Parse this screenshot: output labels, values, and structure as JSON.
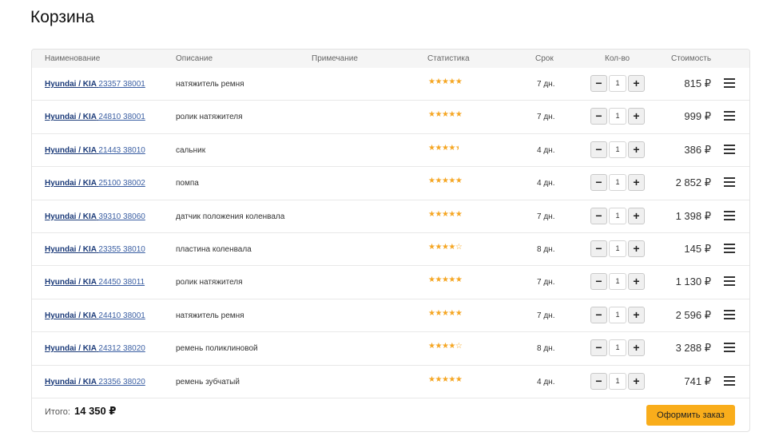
{
  "page": {
    "title": "Корзина"
  },
  "headers": {
    "name": "Наименование",
    "description": "Описание",
    "note": "Примечание",
    "stats": "Статистика",
    "term": "Срок",
    "qty": "Кол-во",
    "cost": "Стоимость"
  },
  "icons": {
    "decrement": "minus-icon",
    "increment": "plus-icon",
    "menu": "hamburger-menu-icon",
    "rating": "star-icon"
  },
  "colors": {
    "accent": "#f9ad1b",
    "star": "#f5a623",
    "link": "#1d3c7a"
  },
  "items": [
    {
      "brand": "Hyundai / KIA",
      "article": "23357 38001",
      "description": "натяжитель ремня",
      "rating": 5,
      "term": "7 дн.",
      "qty": "1",
      "cost": "815 ₽"
    },
    {
      "brand": "Hyundai / KIA",
      "article": "24810 38001",
      "description": "ролик натяжителя",
      "rating": 5,
      "term": "7 дн.",
      "qty": "1",
      "cost": "999 ₽"
    },
    {
      "brand": "Hyundai / KIA",
      "article": "21443 38010",
      "description": "сальник",
      "rating": 4.5,
      "term": "4 дн.",
      "qty": "1",
      "cost": "386 ₽"
    },
    {
      "brand": "Hyundai / KIA",
      "article": "25100 38002",
      "description": "помпа",
      "rating": 5,
      "term": "4 дн.",
      "qty": "1",
      "cost": "2 852 ₽"
    },
    {
      "brand": "Hyundai / KIA",
      "article": "39310 38060",
      "description": "датчик положения коленвала",
      "rating": 5,
      "term": "7 дн.",
      "qty": "1",
      "cost": "1 398 ₽"
    },
    {
      "brand": "Hyundai / KIA",
      "article": "23355 38010",
      "description": "пластина коленвала",
      "rating": 4,
      "term": "8 дн.",
      "qty": "1",
      "cost": "145 ₽"
    },
    {
      "brand": "Hyundai / KIA",
      "article": "24450 38011",
      "description": "ролик натяжителя",
      "rating": 5,
      "term": "7 дн.",
      "qty": "1",
      "cost": "1 130 ₽"
    },
    {
      "brand": "Hyundai / KIA",
      "article": "24410 38001",
      "description": "натяжитель ремня",
      "rating": 5,
      "term": "7 дн.",
      "qty": "1",
      "cost": "2 596 ₽"
    },
    {
      "brand": "Hyundai / KIA",
      "article": "24312 38020",
      "description": "ремень поликлиновой",
      "rating": 4,
      "term": "8 дн.",
      "qty": "1",
      "cost": "3 288 ₽"
    },
    {
      "brand": "Hyundai / KIA",
      "article": "23356 38020",
      "description": "ремень зубчатый",
      "rating": 5,
      "term": "4 дн.",
      "qty": "1",
      "cost": "741 ₽"
    }
  ],
  "footer": {
    "total_label": "Итого:",
    "total_value": "14 350 ₽",
    "checkout_label": "Оформить заказ"
  }
}
